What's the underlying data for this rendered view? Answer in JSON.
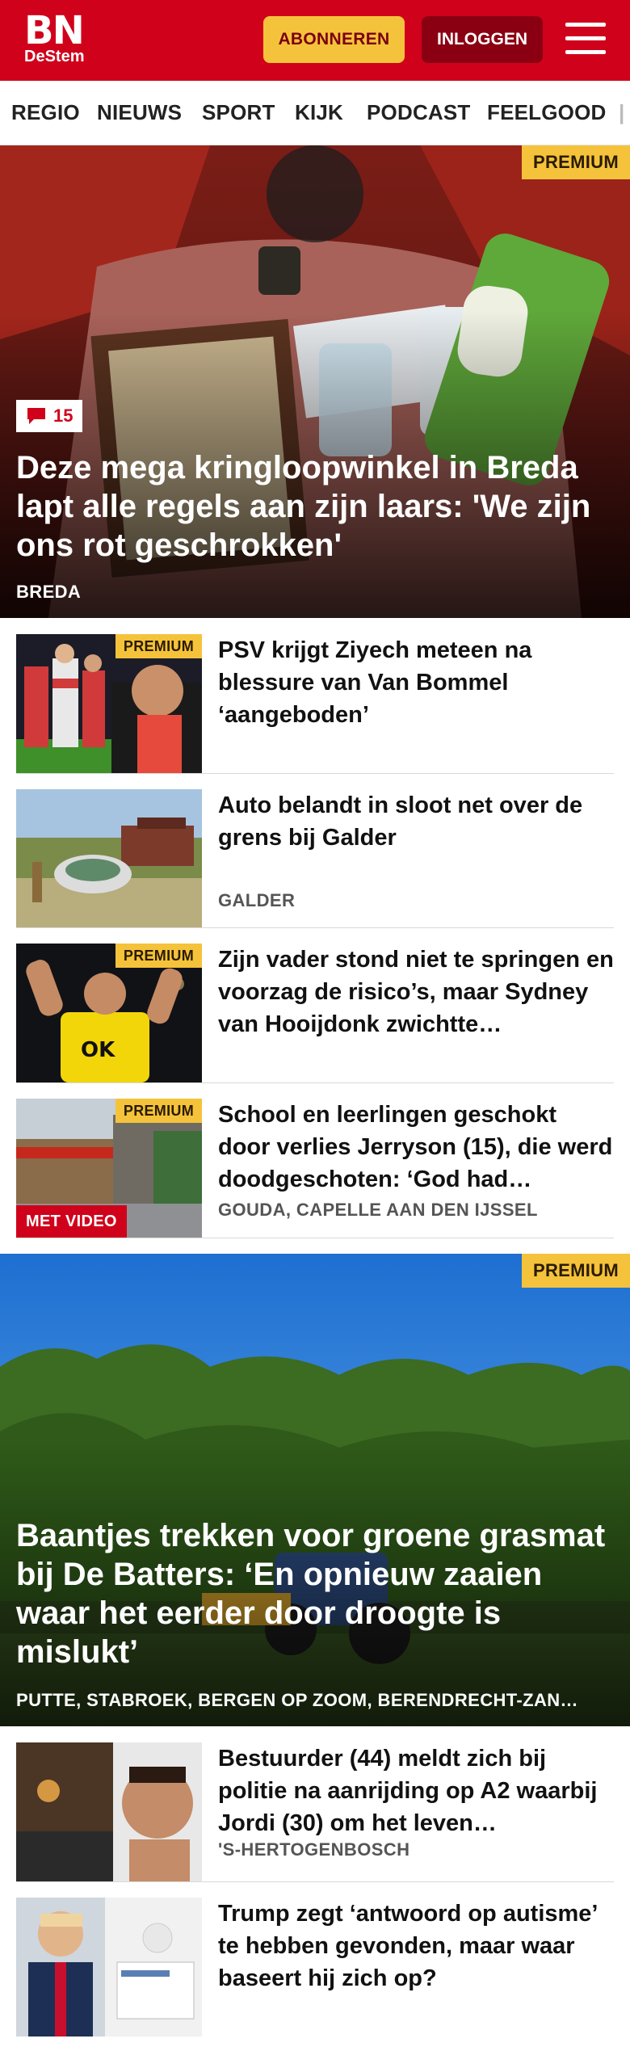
{
  "header": {
    "logo_main": "BN",
    "logo_sub": "DeStem",
    "subscribe_label": "ABONNEREN",
    "login_label": "INLOGGEN",
    "menu_icon": "hamburger-menu-icon",
    "brand_color": "#d0021b",
    "subscribe_color": "#f5c33b",
    "login_color": "#8a0012"
  },
  "nav": {
    "items": [
      "REGIO",
      "NIEUWS",
      "SPORT",
      "KIJK",
      "PODCAST",
      "FEELGOOD"
    ]
  },
  "badges": {
    "premium": "PREMIUM",
    "premium_color": "#f5c33b",
    "video": "MET VIDEO"
  },
  "hero": {
    "comments": "15",
    "comment_icon": "comment-bubble-icon",
    "title": "Deze mega kringloopwinkel in Breda lapt alle regels aan zijn laars: 'We zijn ons rot geschrokken'",
    "location": "BREDA"
  },
  "articles": [
    {
      "title": "PSV krijgt Ziyech meteen na blessure van Van Bommel ‘aangeboden’",
      "location": "",
      "premium": true
    },
    {
      "title": "Auto belandt in sloot net over de grens bij Galder",
      "location": "GALDER",
      "premium": false
    },
    {
      "title": "Zijn vader stond niet te springen en voorzag de risico’s, maar Sydney van Hooijdonk zwichtte…",
      "location": "",
      "premium": true
    },
    {
      "title": "School en leerlingen geschokt door verlies Jerryson (15), die werd doodgeschoten: ‘God had…",
      "location": "GOUDA, CAPELLE AAN DEN IJSSEL",
      "premium": true,
      "video": true
    }
  ],
  "hero2": {
    "title": "Baantjes trekken voor groene grasmat bij De Batters: ‘En opnieuw zaaien waar het eerder door droogte is mislukt’",
    "location": "PUTTE, STABROEK, BERGEN OP ZOOM, BERENDRECHT-ZAN…"
  },
  "articles2": [
    {
      "title": "Bestuurder (44) meldt zich bij politie na aanrijding op A2 waarbij Jordi (30) om het leven…",
      "location": "'S-HERTOGENBOSCH"
    },
    {
      "title": "Trump zegt ‘antwoord op autisme’ te hebben gevonden, maar waar baseert hij zich op?",
      "location": ""
    }
  ]
}
